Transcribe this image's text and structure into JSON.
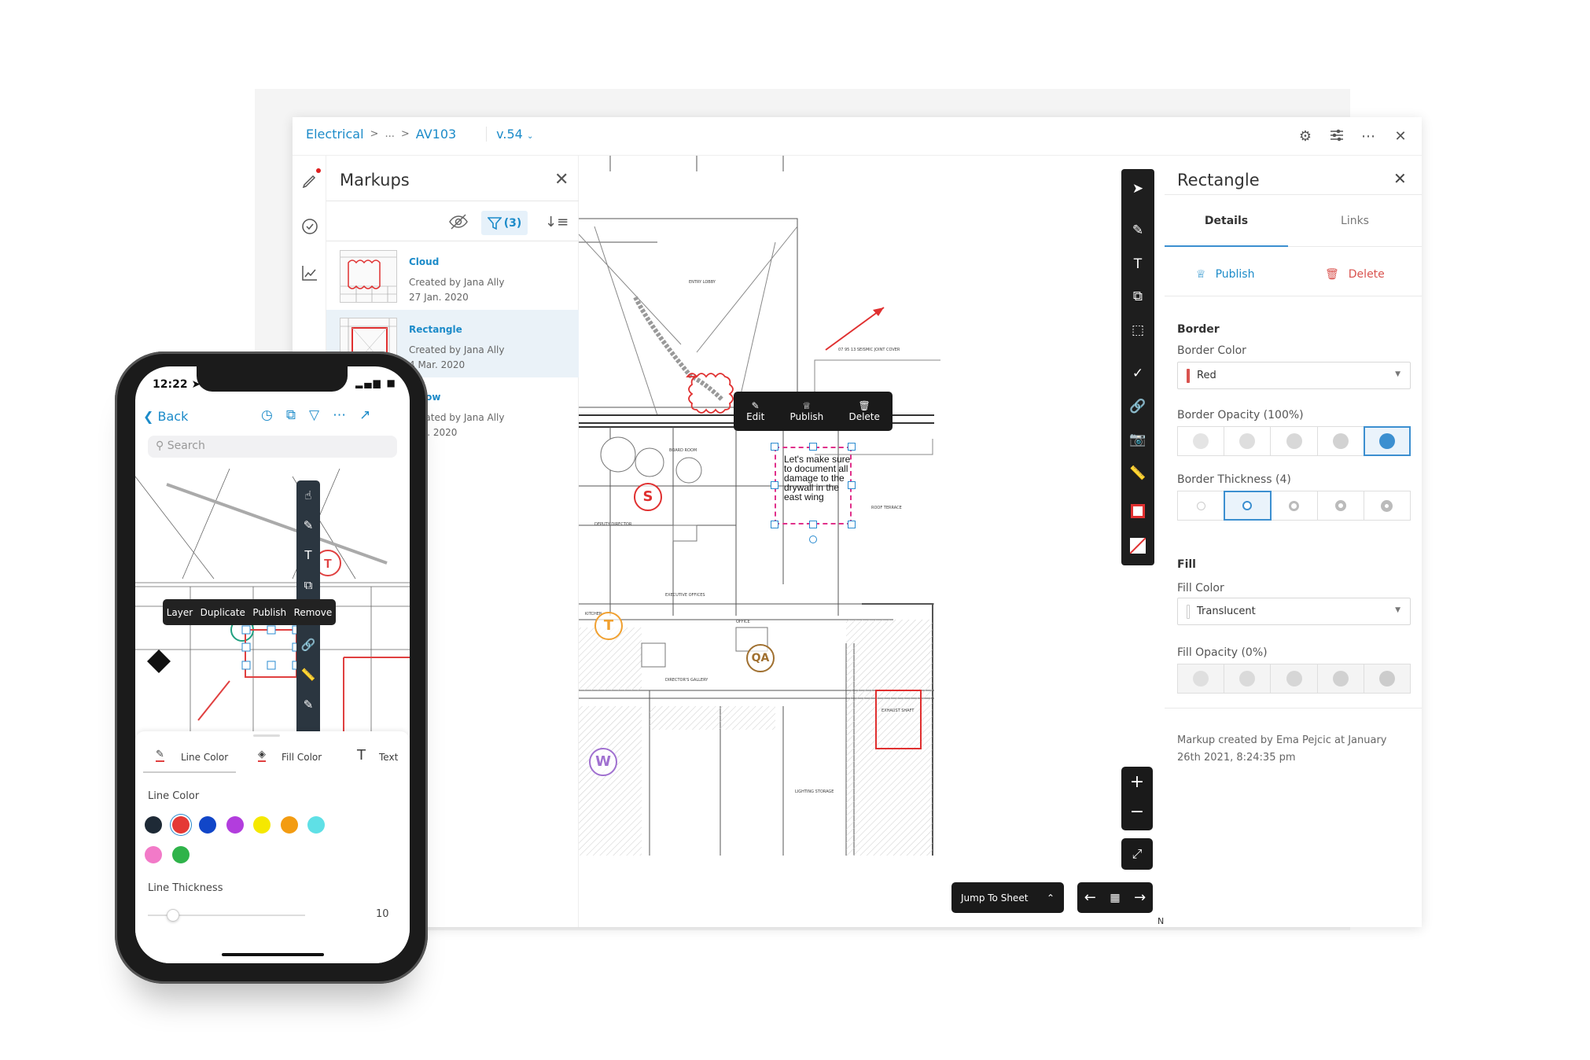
{
  "window": {
    "breadcrumb": {
      "root": "Electrical",
      "sep": ">",
      "ellipsis": "...",
      "sheet": "AV103",
      "version": "v.54"
    },
    "header_icons": [
      "gear-icon",
      "sliders-icon",
      "more-icon",
      "close-icon"
    ],
    "rail_icons": [
      "markup-pen-icon",
      "issues-check-icon",
      "chart-icon"
    ]
  },
  "markups": {
    "title": "Markups",
    "filter_count": "(3)",
    "items": [
      {
        "title": "Cloud",
        "created": "Created by Jana Ally",
        "date": "27 Jan. 2020"
      },
      {
        "title": "Rectangle",
        "created": "Created by Jana Ally",
        "date": "4 Mar. 2020",
        "selected": true
      },
      {
        "title": "Arrow",
        "created": "Created by Jana Ally",
        "date": "Dec. 2020"
      }
    ]
  },
  "canvas": {
    "context_menu": {
      "edit": "Edit",
      "publish": "Publish",
      "delete": "Delete"
    },
    "note_text": "Let's make sure to document all damage to the drywall in the east wing",
    "markers": [
      {
        "label": "S",
        "color": "#e03030"
      },
      {
        "label": "T",
        "color": "#f0a030"
      },
      {
        "label": "QA",
        "color": "#a07030"
      },
      {
        "label": "W",
        "color": "#a070d0"
      }
    ],
    "labels": {
      "entry": "ENTRY LOBBY",
      "board": "BOARD ROOM",
      "deputy": "DEPUTY DIRECTOR",
      "exec": "EXECUTIVE OFFICES",
      "gallery": "DIRECTOR'S GALLERY",
      "office": "OFFICE",
      "kitchen": "KITCHEN",
      "exhaust": "EXHAUST SHAFT",
      "lighting": "LIGHTING STORAGE",
      "seismic": "07 95 13 SEISMIC JOINT COVER",
      "roof": "ROOF TERRACE",
      "north": "N"
    },
    "jump_to_sheet": "Jump To Sheet",
    "tools": [
      "select-icon",
      "pen-icon",
      "text-icon",
      "shapes-icon",
      "lasso-icon",
      "check-icon",
      "link-icon",
      "camera-icon",
      "ruler-icon",
      "border-color-icon",
      "fill-color-icon"
    ]
  },
  "properties": {
    "title": "Rectangle",
    "tabs": [
      "Details",
      "Links"
    ],
    "active_tab": "Details",
    "publish": "Publish",
    "delete": "Delete",
    "border_heading": "Border",
    "border_color_label": "Border Color",
    "border_color": "Red",
    "border_color_hex": "#d9534f",
    "border_opacity_label": "Border Opacity (100%)",
    "border_opacity_selected": 5,
    "border_thickness_label": "Border Thickness (4)",
    "border_thickness_selected": 2,
    "fill_heading": "Fill",
    "fill_color_label": "Fill Color",
    "fill_color": "Translucent",
    "fill_opacity_label": "Fill Opacity (0%)",
    "note": "Markup created by Ema Pejcic at January 26th 2021, 8:24:35 pm"
  },
  "phone": {
    "time": "12:22",
    "back": "Back",
    "search_placeholder": "Search",
    "context_menu": [
      "Layer",
      "Duplicate",
      "Publish",
      "Remove"
    ],
    "tabs": [
      "Line Color",
      "Fill Color",
      "Text"
    ],
    "line_color_label": "Line Color",
    "colors": [
      "#1e2a36",
      "#e53935",
      "#1146c8",
      "#b23ddd",
      "#f5e800",
      "#f39c12",
      "#5fe0e6",
      "#f27ac8",
      "#2fb34a"
    ],
    "selected_color": "#e53935",
    "line_thickness_label": "Line Thickness",
    "line_thickness": "10"
  }
}
